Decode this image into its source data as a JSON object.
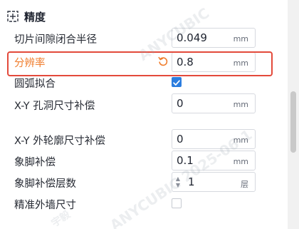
{
  "section": {
    "title": "精度"
  },
  "settings": [
    {
      "label": "切片间隙闭合半径",
      "value": "0.049",
      "unit": "mm"
    },
    {
      "label": "分辨率",
      "value": "0.8",
      "unit": "mm"
    },
    {
      "label": "圆弧拟合"
    },
    {
      "label": "X-Y 孔洞尺寸补偿",
      "value": "0",
      "unit": "mm"
    },
    {
      "label": "X-Y 外轮廓尺寸补偿",
      "value": "0",
      "unit": "mm"
    },
    {
      "label": "象脚补偿",
      "value": "0.1",
      "unit": "mm"
    },
    {
      "label": "象脚补偿层数",
      "value": "1",
      "unit": "层"
    },
    {
      "label": "精准外墙尺寸"
    }
  ],
  "states": {
    "arc_fitting_checked": true,
    "precise_wall_checked": false
  },
  "watermark": {
    "line1": "ANYCUBIC 2025-06-1",
    "line2": "ANYCUBIC",
    "line3": "宇毅"
  },
  "colors": {
    "accent_modified": "#f07d2d",
    "highlight": "#e34a3b",
    "checkbox": "#2b7ddf"
  }
}
